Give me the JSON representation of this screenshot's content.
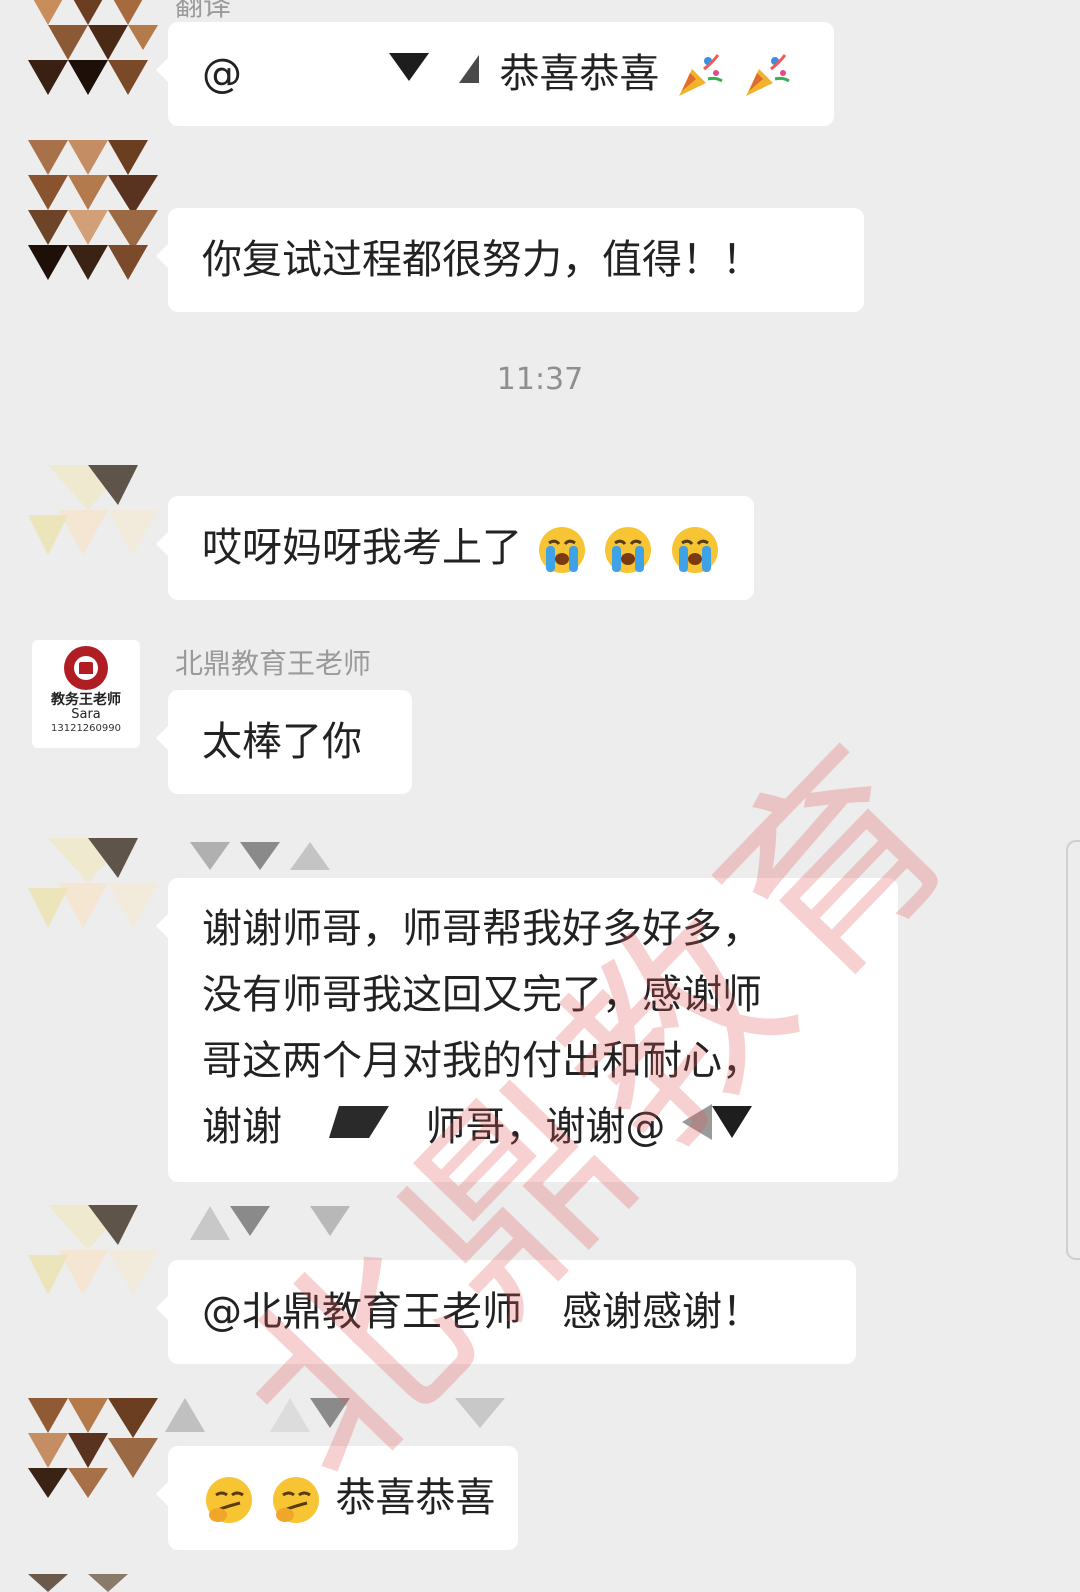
{
  "chat": {
    "top_sender_fragment": "翻译",
    "timestamp": "11:37",
    "messages": [
      {
        "sender": "",
        "text_prefix": "@",
        "text": "恭喜恭喜",
        "emojis": [
          "party-popper",
          "party-popper"
        ]
      },
      {
        "sender": "",
        "text": "你复试过程都很努力，值得！！"
      },
      {
        "sender": "",
        "text": "哎呀妈呀我考上了",
        "emojis": [
          "loudly-crying-face",
          "loudly-crying-face",
          "loudly-crying-face"
        ]
      },
      {
        "sender": "北鼎教育王老师",
        "text": "太棒了你"
      },
      {
        "sender": "",
        "lines": [
          "谢谢师哥，师哥帮我好多好多，",
          "没有师哥我这回又完了，感谢师",
          "哥这两个月对我的付出和耐心，"
        ],
        "last_line_a": "谢谢",
        "last_line_b": "师哥，谢谢@"
      },
      {
        "sender": "",
        "text": "@北鼎教育王老师　感谢感谢！"
      },
      {
        "sender": "",
        "text": "恭喜恭喜",
        "emojis": [
          "smirking-face",
          "smirking-face"
        ]
      }
    ]
  },
  "brand_avatar": {
    "title": "教务王老师",
    "name": "Sara",
    "phone": "13121260990"
  },
  "watermark": "北鼎教育",
  "colors": {
    "background": "#ededed",
    "bubble": "#ffffff",
    "watermark": "#e15a5a",
    "brand_red": "#b01e24"
  }
}
